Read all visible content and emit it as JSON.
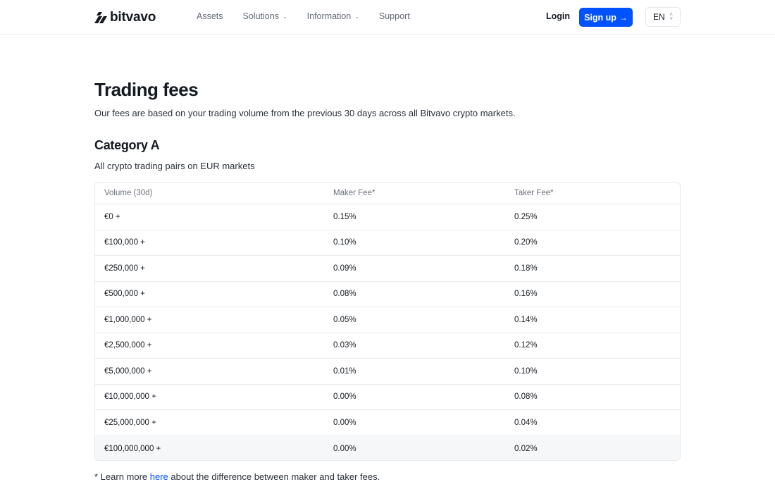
{
  "brand": {
    "name": "bitvavo",
    "accent": "#0051ff"
  },
  "nav": {
    "assets": "Assets",
    "solutions": "Solutions",
    "information": "Information",
    "support": "Support"
  },
  "header": {
    "login": "Login",
    "signup": "Sign up",
    "language": "EN"
  },
  "page": {
    "title": "Trading fees",
    "subtitle": "Our fees are based on your trading volume from the previous 30 days across all Bitvavo crypto markets."
  },
  "category": {
    "title": "Category A",
    "subtitle": "All crypto trading pairs on EUR markets",
    "columns": [
      "Volume (30d)",
      "Maker Fee*",
      "Taker Fee*"
    ],
    "rows": [
      [
        "€0 +",
        "0.15%",
        "0.25%"
      ],
      [
        "€100,000 +",
        "0.10%",
        "0.20%"
      ],
      [
        "€250,000 +",
        "0.09%",
        "0.18%"
      ],
      [
        "€500,000 +",
        "0.08%",
        "0.16%"
      ],
      [
        "€1,000,000 +",
        "0.05%",
        "0.14%"
      ],
      [
        "€2,500,000 +",
        "0.03%",
        "0.12%"
      ],
      [
        "€5,000,000 +",
        "0.01%",
        "0.10%"
      ],
      [
        "€10,000,000 +",
        "0.00%",
        "0.08%"
      ],
      [
        "€25,000,000 +",
        "0.00%",
        "0.04%"
      ],
      [
        "€100,000,000 +",
        "0.00%",
        "0.02%"
      ]
    ]
  },
  "footnote": {
    "prefix": "* Learn more ",
    "link": "here",
    "suffix": " about the difference between maker and taker fees."
  }
}
